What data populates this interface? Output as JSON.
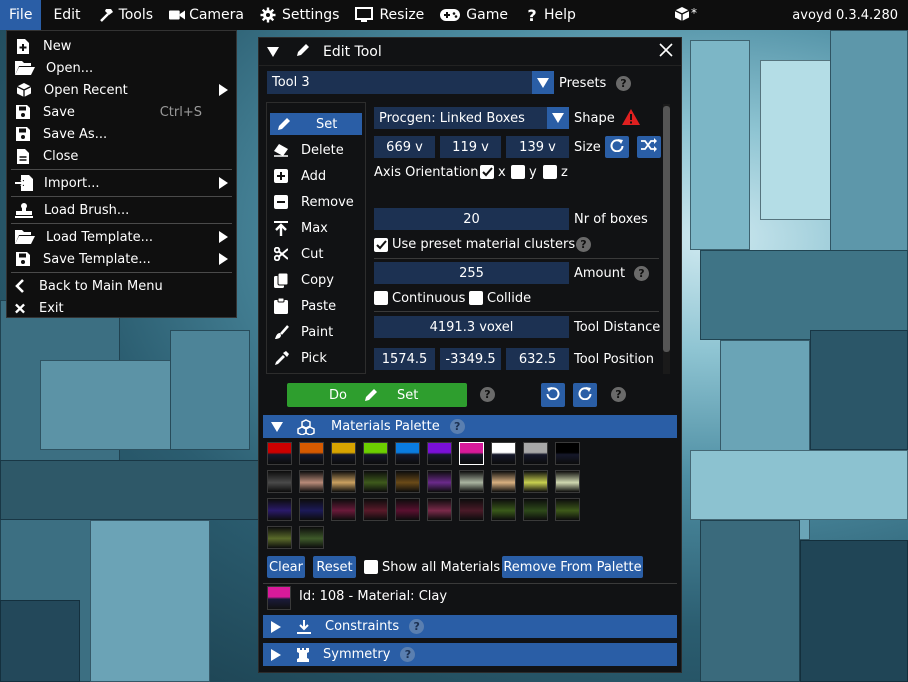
{
  "menubar": {
    "items": [
      {
        "label": "File",
        "icon": ""
      },
      {
        "label": "Edit",
        "icon": ""
      },
      {
        "label": "Tools",
        "icon": "hammer-icon"
      },
      {
        "label": "Camera",
        "icon": "video-camera-icon"
      },
      {
        "label": "Settings",
        "icon": "gear-icon"
      },
      {
        "label": "Resize",
        "icon": "monitor-icon"
      },
      {
        "label": "Game",
        "icon": "gamepad-icon"
      },
      {
        "label": "Help",
        "icon": "question-icon"
      }
    ],
    "cube_badge": "*",
    "version": "avoyd 0.3.4.280",
    "active_color": "#2a5ea6"
  },
  "file_menu": {
    "items": [
      {
        "label": "New",
        "icon": "new-file-icon",
        "shortcut": "",
        "submenu": false
      },
      {
        "label": "Open...",
        "icon": "folder-open-icon",
        "shortcut": "",
        "submenu": false
      },
      {
        "label": "Open Recent",
        "icon": "cube-icon",
        "shortcut": "",
        "submenu": true
      },
      {
        "label": "Save",
        "icon": "floppy-icon",
        "shortcut": "Ctrl+S",
        "submenu": false
      },
      {
        "label": "Save As...",
        "icon": "floppy-icon",
        "shortcut": "",
        "submenu": false
      },
      {
        "label": "Close",
        "icon": "file-icon",
        "shortcut": "",
        "submenu": false
      },
      {
        "label": "Import...",
        "icon": "import-icon",
        "shortcut": "",
        "submenu": true
      },
      {
        "label": "Load Brush...",
        "icon": "stamp-icon",
        "shortcut": "",
        "submenu": false
      },
      {
        "label": "Load Template...",
        "icon": "folder-open-icon",
        "shortcut": "",
        "submenu": true
      },
      {
        "label": "Save Template...",
        "icon": "floppy-icon",
        "shortcut": "",
        "submenu": true
      },
      {
        "label": "Back to Main Menu",
        "icon": "chevron-left-icon",
        "shortcut": "",
        "submenu": false
      },
      {
        "label": "Exit",
        "icon": "close-icon",
        "shortcut": "",
        "submenu": false
      }
    ]
  },
  "edit_tool": {
    "title": "Edit Tool",
    "preset_value": "Tool 3",
    "presets_label": "Presets",
    "tools": [
      {
        "label": "Set",
        "icon": "pencil-icon",
        "selected": true
      },
      {
        "label": "Delete",
        "icon": "eraser-icon",
        "selected": false
      },
      {
        "label": "Add",
        "icon": "plus-square-icon",
        "selected": false
      },
      {
        "label": "Remove",
        "icon": "minus-square-icon",
        "selected": false
      },
      {
        "label": "Max",
        "icon": "arrow-up-bar-icon",
        "selected": false
      },
      {
        "label": "Cut",
        "icon": "scissors-icon",
        "selected": false
      },
      {
        "label": "Copy",
        "icon": "copy-icon",
        "selected": false
      },
      {
        "label": "Paste",
        "icon": "paste-icon",
        "selected": false
      },
      {
        "label": "Paint",
        "icon": "paintbrush-icon",
        "selected": false
      },
      {
        "label": "Pick",
        "icon": "eyedropper-icon",
        "selected": false
      }
    ],
    "shape_value": "Procgen: Linked Boxes",
    "shape_label": "Shape",
    "size": {
      "x": "669 v",
      "y": "119 v",
      "z": "139 v",
      "label": "Size"
    },
    "axis_orientation": {
      "label": "Axis Orientation",
      "x": "x",
      "y": "y",
      "z": "z",
      "x_checked": true,
      "y_checked": false,
      "z_checked": false
    },
    "nr_boxes": {
      "value": "20",
      "label": "Nr of boxes"
    },
    "preset_clusters": {
      "label": "Use preset material clusters",
      "checked": true
    },
    "amount": {
      "value": "255",
      "label": "Amount"
    },
    "continuous": {
      "label": "Continuous",
      "checked": false
    },
    "collide": {
      "label": "Collide",
      "checked": false
    },
    "tool_distance": {
      "value": "4191.3 voxel",
      "label": "Tool Distance"
    },
    "tool_position": {
      "x": "1574.5",
      "y": "-3349.5",
      "z": "632.5",
      "label": "Tool Position"
    },
    "do_button": {
      "left": "Do",
      "right": "Set"
    },
    "do_color": "#2e9e2e"
  },
  "materials": {
    "title": "Materials Palette",
    "swatches": [
      [
        "#cc0000",
        "#d65a00",
        "#d8a400",
        "#6ccf00",
        "#0a7ce0",
        "#7a10d8",
        "#d81a9a",
        "#ffffff",
        "#a8a8a8",
        "#000000"
      ],
      [
        "#4a4a4a",
        "#b88a78",
        "#caa060",
        "#3e5a1c",
        "#6a4a18",
        "#6a2a8a",
        "#aab4a0",
        "#d8b080",
        "#c8d050",
        "#d0d8b0"
      ],
      [
        "#2a1a6a",
        "#1c1a58",
        "#6a1a3a",
        "#5a1a2a",
        "#5a1030",
        "#7a2a4a",
        "#4a1a28",
        "#3a5a1a",
        "#2e4a1a",
        "#3e5a1a"
      ],
      [
        "#5a6a2a",
        "#3e5a2a"
      ]
    ],
    "clear_label": "Clear",
    "reset_label": "Reset",
    "show_all_label": "Show all Materials",
    "remove_label": "Remove From Palette",
    "selected_color": "#d81a9a",
    "selected_text": "Id: 108 - Material: Clay"
  },
  "constraints_label": "Constraints",
  "symmetry_label": "Symmetry"
}
